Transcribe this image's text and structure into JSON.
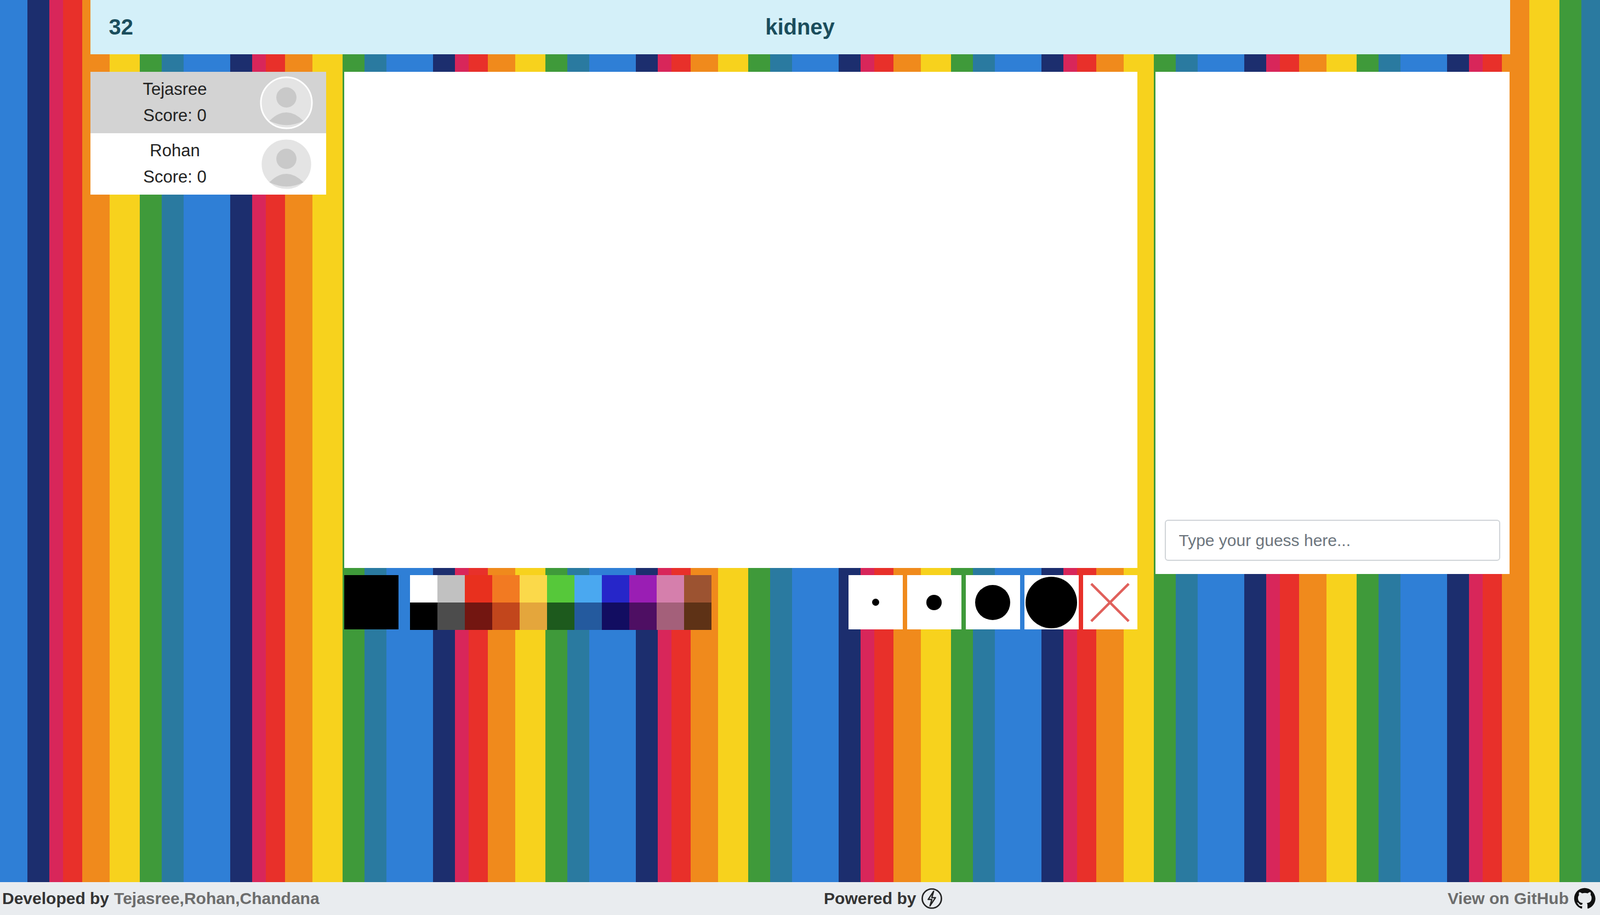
{
  "top_bar": {
    "timer": "32",
    "word": "kidney"
  },
  "players": [
    {
      "name": "Tejasree",
      "score": "Score: 0",
      "selected": true
    },
    {
      "name": "Rohan",
      "score": "Score: 0",
      "selected": false
    }
  ],
  "palette": {
    "current_color": "#000000",
    "colors": [
      {
        "color": "#ffffff"
      },
      {
        "color": "#c1c1c1"
      },
      {
        "color": "#e8301e"
      },
      {
        "color": "#f27a22"
      },
      {
        "color": "#fbd94a"
      },
      {
        "color": "#56c83a"
      },
      {
        "color": "#4aa8f0"
      },
      {
        "color": "#2626c9"
      },
      {
        "color": "#9a1eb4"
      },
      {
        "color": "#d57fac"
      },
      {
        "color": "#9c5331"
      },
      {
        "color": "#000000"
      },
      {
        "color": "#4c4c4c"
      },
      {
        "color": "#731611"
      },
      {
        "color": "#c2461c"
      },
      {
        "color": "#e4a63c"
      },
      {
        "color": "#1d5a1d"
      },
      {
        "color": "#245a9e"
      },
      {
        "color": "#120d61"
      },
      {
        "color": "#4e0f63"
      },
      {
        "color": "#a4607a"
      },
      {
        "color": "#5e3216"
      }
    ]
  },
  "tools": [
    {
      "kind": "small"
    },
    {
      "kind": "medium"
    },
    {
      "kind": "large"
    },
    {
      "kind": "xlarge"
    },
    {
      "kind": "clear"
    }
  ],
  "chat": {
    "messages": [],
    "placeholder": "Type your guess here..."
  },
  "footer": {
    "developed_label": "Developed by",
    "developers": "Tejasree,Rohan,Chandana",
    "powered_label": "Powered by",
    "github_label": "View on GitHub"
  }
}
